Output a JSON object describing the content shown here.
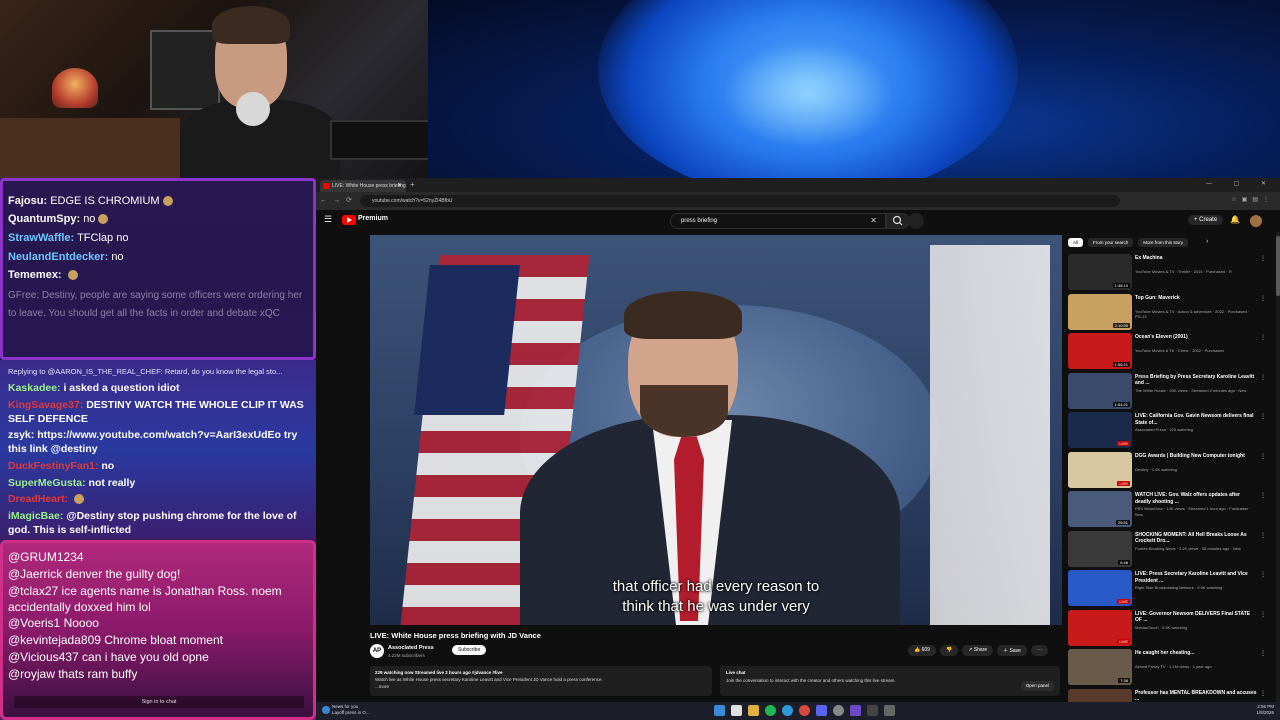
{
  "chat": {
    "top": [
      {
        "user": "Fajosu:",
        "user_color": "#ffffff",
        "text": "EDGE IS CHROMIUM"
      },
      {
        "user": "QuantumSpy:",
        "user_color": "#ffffff",
        "text": "no"
      },
      {
        "user": "StrawWaffle:",
        "user_color": "#6ec6ff",
        "text": "TFClap no"
      },
      {
        "user": "NeulandEntdecker:",
        "user_color": "#6ec6ff",
        "text": "no"
      },
      {
        "user": "Tememex:",
        "user_color": "#ffffff",
        "text": ""
      }
    ],
    "faded_message": "GFree: Destiny, people are saying some officers were ordering her to leave. You should get all the facts in order and debate xQC",
    "reply_line": "Replying to @AARON_IS_THE_REAL_CHEF: Retard, do you know the legal sto...",
    "mid": [
      {
        "user": "Kaskadee:",
        "user_color": "#9bf08a",
        "text": "i asked a question idiot"
      },
      {
        "user": "KingSavage37:",
        "user_color": "#e03a3a",
        "text": "DESTINY WATCH THE WHOLE CLIP IT WAS SELF DEFENCE"
      },
      {
        "user": "zsyk:",
        "user_color": "#ffffff",
        "text": "https://www.youtube.com/watch?v=AarI3exUdEo try this link @destiny"
      },
      {
        "user": "DuckFestinyFan1:",
        "user_color": "#e03a3a",
        "text": "no"
      },
      {
        "user": "SuperMeGusta:",
        "user_color": "#9bf08a",
        "text": "not really"
      },
      {
        "user": "DreadHeart:",
        "user_color": "#e03a3a",
        "text": ""
      },
      {
        "user": "iMagicBae:",
        "user_color": "#9bf08a",
        "text": "@Destiny stop pushing chrome for the love of god. This is self-inflicted"
      }
    ],
    "bottom": [
      {
        "user": "@GRUM1234",
        "text": ""
      },
      {
        "user": "@Jaerrick",
        "text": "denver the guilty dog!"
      },
      {
        "user": "@tclax27",
        "text": "ice agents name is Jonathan Ross. noem accidentally doxxed him lol"
      },
      {
        "user": "@Voeris1",
        "text": "Noooo"
      },
      {
        "user": "@kevintejada809",
        "text": "Chrome bloat moment"
      },
      {
        "user": "@Vicious437",
        "text": "can i have you old opne"
      },
      {
        "user": "@royjaw",
        "text": "thats ram buffy"
      }
    ],
    "signin": "Sign in to chat"
  },
  "browser": {
    "tab_title": "LIVE: White House press briefing",
    "url": "youtube.com/watch?v=52nyZI4BfbU",
    "new_tab": "+",
    "window_controls": "— ▢ ✕"
  },
  "youtube": {
    "brand": "Premium",
    "search_value": "press briefing",
    "create": "+ Create",
    "captions_line1": "that officer had every reason to",
    "captions_line2": "think that he was under very",
    "video_title": "LIVE: White House press briefing with JD Vance",
    "channel_initials": "AP",
    "channel_name": "Associated Press",
    "channel_subs": "4.22M subscribers",
    "subscribe": "Subscribe",
    "likes": "609",
    "share": "Share",
    "save": "Save",
    "desc_stats": "229 watching now  Streamed live 2 hours ago  #jdvance #live",
    "desc_text": "Watch live as White House press secretary Karoline Leavitt and Vice President JD Vance hold a press conference.",
    "desc_more": "...more",
    "livechat_title": "Live chat",
    "livechat_text": "Join the conversation to interact with the creator and others watching this live stream.",
    "open_panel": "Open panel",
    "chips": [
      "All",
      "From your search",
      "More from this story"
    ],
    "recs": [
      {
        "title": "Ex Machina",
        "meta": "YouTube Movies & TV · Thriller · 2015 · Purchased · R",
        "badge": "1:48:15",
        "color": "#2a2a2a"
      },
      {
        "title": "Top Gun: Maverick",
        "meta": "YouTube Movies & TV · Action & adventure · 2022 · Purchased · PG-13",
        "badge": "2:10:55",
        "color": "#c8a060"
      },
      {
        "title": "Ocean's Eleven (2001)",
        "meta": "YouTube Movies & TV · Crime · 2002 · Purchased",
        "badge": "1:56:21",
        "color": "#c81a1a"
      },
      {
        "title": "Press Briefing by Press Secretary Karoline Leavitt and ...",
        "meta": "The White House · 20K views · Streamed 2 minutes ago · New",
        "badge": "1:54:21",
        "color": "#3a4a6a"
      },
      {
        "title": "LIVE: California Gov. Gavin Newsom delivers final State of...",
        "meta": "Associated Press · 223 watching",
        "badge": "LIVE",
        "color": "#1a2a4a"
      },
      {
        "title": "DGG Awards | Building New Computer tonight",
        "meta": "Destiny · 1.6K watching",
        "badge": "LIVE",
        "color": "#d8c8a0"
      },
      {
        "title": "WATCH LIVE: Gov. Walz offers updates after deadly shooting ...",
        "meta": "PBS NewsHour · 14K views · Streamed 1 hour ago · Fundraiser · New",
        "badge": "26:51",
        "color": "#4a5a7a"
      },
      {
        "title": "SHOCKING MOMENT: All Hell Breaks Loose As Crockett Dro...",
        "meta": "Forbes Breaking News · 3.2K views · 58 minutes ago · New",
        "badge": "6:48",
        "color": "#3a3a3a"
      },
      {
        "title": "LIVE: Press Secretary Karoline Leavitt and Vice President ...",
        "meta": "Right Side Broadcasting Network · 9.9K watching",
        "badge": "LIVE",
        "color": "#2a5ac8"
      },
      {
        "title": "LIVE: Governor Newsom DELIVERS Final STATE OF ...",
        "meta": "MeidasTouch · 5.5K watching",
        "badge": "LIVE",
        "color": "#c81a1a"
      },
      {
        "title": "He caught her cheating...",
        "meta": "Almost Friday TV · 1.1M views · 1 year ago",
        "badge": "7:38",
        "color": "#6a5a4a"
      },
      {
        "title": "Professor has MENTAL BREAKDOWN and accuses ...",
        "meta": "",
        "badge": "",
        "color": "#5a3a2a"
      }
    ]
  },
  "taskbar": {
    "news_title": "News for you",
    "news_sub": "Layoff press in O...",
    "time": "2:56 PM",
    "date": "1/8/2026"
  }
}
